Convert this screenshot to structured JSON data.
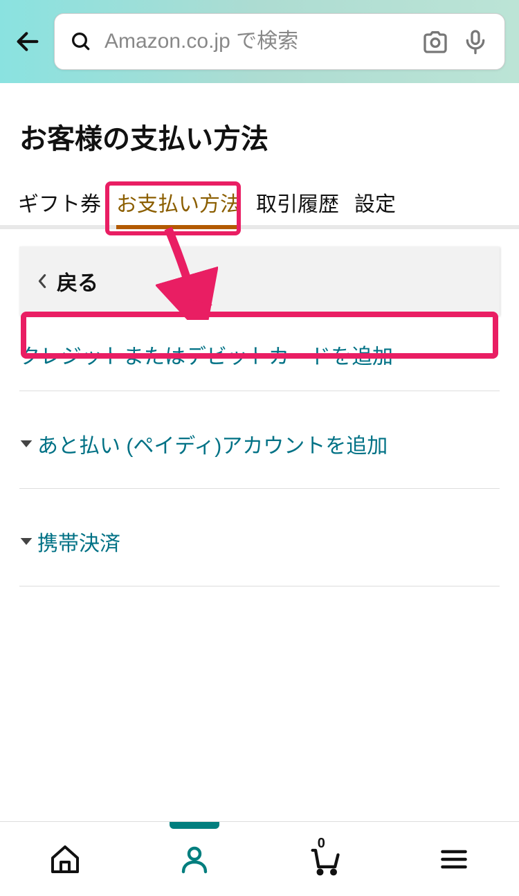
{
  "header": {
    "search_placeholder": "Amazon.co.jp で検索"
  },
  "page_title": "お客様の支払い方法",
  "tabs": [
    {
      "label": "ギフト券",
      "active": false
    },
    {
      "label": "お支払い方法",
      "active": true
    },
    {
      "label": "取引履歴",
      "active": false
    },
    {
      "label": "設定",
      "active": false
    }
  ],
  "back_row": {
    "label": "戻る"
  },
  "options": [
    {
      "label": "クレジットまたはデビットカードを追加"
    },
    {
      "label": "あと払い (ペイディ)アカウントを追加"
    },
    {
      "label": "携帯決済"
    }
  ],
  "bottom_nav": {
    "cart_count": "0"
  }
}
